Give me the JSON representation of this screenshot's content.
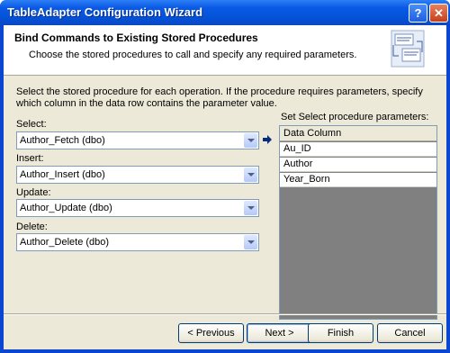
{
  "window": {
    "title": "TableAdapter Configuration Wizard",
    "help_glyph": "?",
    "close_glyph": "✕"
  },
  "header": {
    "title": "Bind Commands to Existing Stored Procedures",
    "subtitle": "Choose the stored procedures to call and specify any required parameters.",
    "logo_icon": "database-wizard-icon"
  },
  "description": "Select the stored procedure for each operation. If the procedure requires parameters, specify which column in the data row contains the parameter value.",
  "operations": {
    "select": {
      "label": "Select:",
      "value": "Author_Fetch (dbo)"
    },
    "insert": {
      "label": "Insert:",
      "value": "Author_Insert (dbo)"
    },
    "update": {
      "label": "Update:",
      "value": "Author_Update (dbo)"
    },
    "delete": {
      "label": "Delete:",
      "value": "Author_Delete (dbo)"
    }
  },
  "parameters": {
    "label": "Set Select procedure parameters:",
    "column_header": "Data Column",
    "rows": [
      "Au_ID",
      "Author",
      "Year_Born"
    ]
  },
  "buttons": {
    "previous": "< Previous",
    "next": "Next >",
    "finish": "Finish",
    "cancel": "Cancel"
  },
  "colors": {
    "titlebar": "#0a5ae6",
    "dialog_bg": "#ece9d8"
  }
}
